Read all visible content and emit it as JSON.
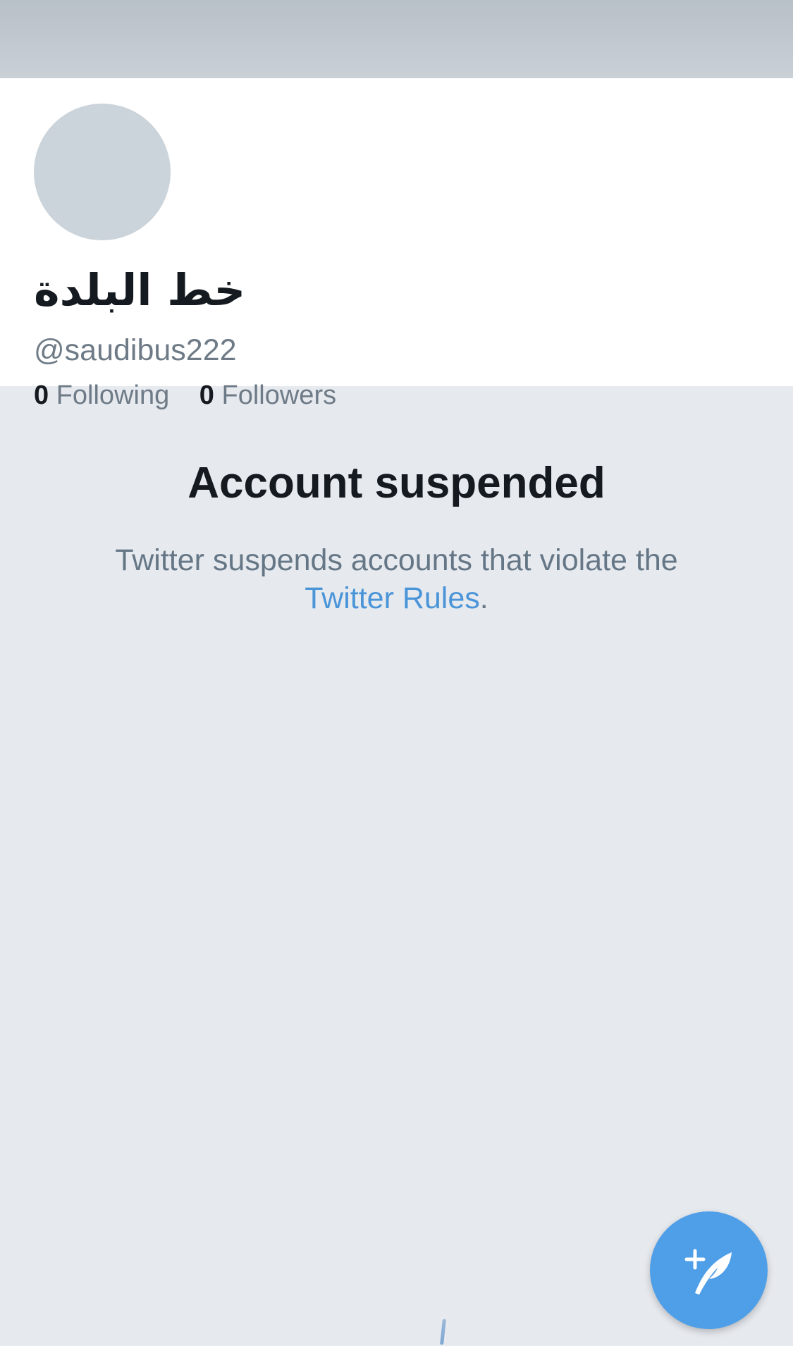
{
  "profile": {
    "display_name": "خط البلدة",
    "handle": "@saudibus222",
    "following_count": "0",
    "following_label": "Following",
    "followers_count": "0",
    "followers_label": "Followers"
  },
  "suspension": {
    "title": "Account suspended",
    "message_prefix": "Twitter suspends accounts that violate the",
    "rules_link": "Twitter Rules",
    "message_suffix": "."
  },
  "compose": {
    "icon": "compose-feather-plus-icon"
  },
  "colors": {
    "link": "#4a95d8",
    "fab": "#4f9fe8",
    "background": "#e6e9ee",
    "text_primary": "#141a1f",
    "text_secondary": "#6e7b87"
  }
}
